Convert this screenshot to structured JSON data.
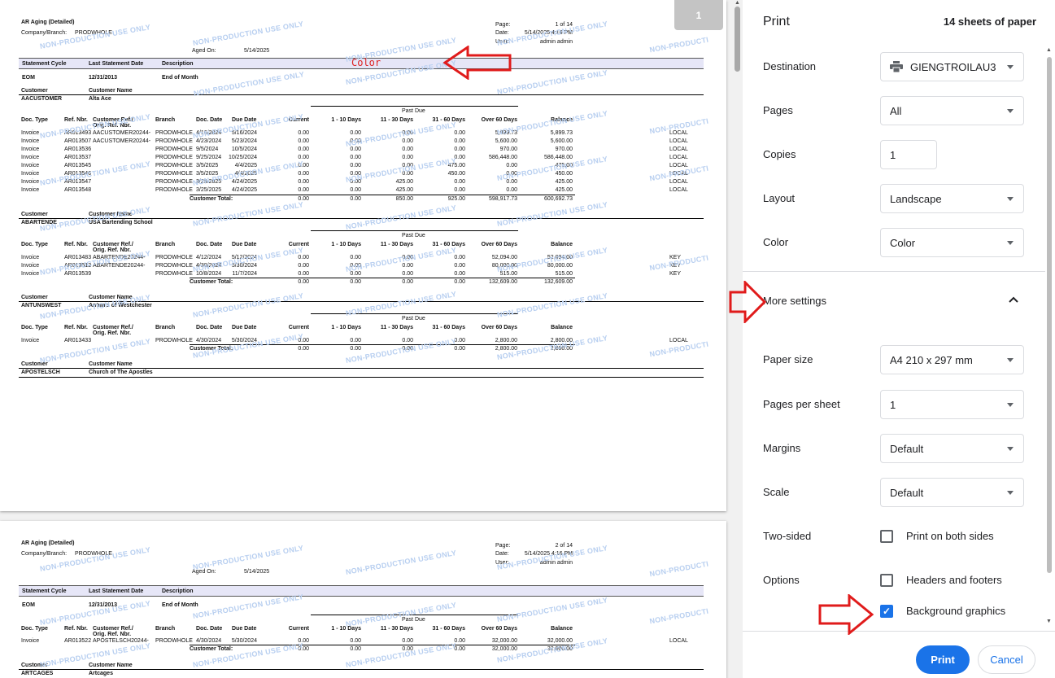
{
  "report": {
    "title": "AR Aging (Detailed)",
    "company_label": "Company/Branch:",
    "company": "PRODWHOLE",
    "aged_on_label": "Aged On:",
    "aged_on": "5/14/2025",
    "page_label": "Page:",
    "page1": "1 of 14",
    "page2": "2 of 14",
    "date_label": "Date:",
    "date": "5/14/2025 4:16 PM",
    "user_label": "User:",
    "user": "admin admin",
    "watermark": "NON-PRODUCTION USE ONLY",
    "watermark_cut": "NON-PRODUCTI",
    "band_cols": [
      "Statement Cycle",
      "Last Statement Date",
      "Description"
    ],
    "cycle": [
      "EOM",
      "12/31/2013",
      "End of Month"
    ],
    "cust_header": [
      "Customer",
      "Customer Name"
    ],
    "past_due": "Past Due",
    "col_heads": [
      "Doc. Type",
      "Ref. Nbr.",
      "Customer Ref./",
      "Orig. Ref. Nbr.",
      "Branch",
      "Doc. Date",
      "Due Date",
      "Current",
      "1 - 10 Days",
      "11 - 30 Days",
      "31 - 60 Days",
      "Over 60 Days",
      "Balance"
    ],
    "customer_total": "Customer Total:",
    "groups": [
      {
        "id": "AACUSTOMER",
        "name": "Alta Ace",
        "rows": [
          [
            "Invoice",
            "AR013493",
            "AACUSTOMER20244-",
            "PRODWHOLE",
            "4/16/2024",
            "5/16/2024",
            "0.00",
            "0.00",
            "0.00",
            "0.00",
            "5,899.73",
            "5,899.73",
            "LOCAL"
          ],
          [
            "Invoice",
            "AR013507",
            "AACUSTOMER20244-",
            "PRODWHOLE",
            "4/23/2024",
            "5/23/2024",
            "0.00",
            "0.00",
            "0.00",
            "0.00",
            "5,600.00",
            "5,600.00",
            "LOCAL"
          ],
          [
            "Invoice",
            "AR013536",
            "",
            "PRODWHOLE",
            "9/5/2024",
            "10/5/2024",
            "0.00",
            "0.00",
            "0.00",
            "0.00",
            "970.00",
            "970.00",
            "LOCAL"
          ],
          [
            "Invoice",
            "AR013537",
            "",
            "PRODWHOLE",
            "9/25/2024",
            "10/25/2024",
            "0.00",
            "0.00",
            "0.00",
            "0.00",
            "586,448.00",
            "586,448.00",
            "LOCAL"
          ],
          [
            "Invoice",
            "AR013545",
            "",
            "PRODWHOLE",
            "3/5/2025",
            "4/4/2025",
            "0.00",
            "0.00",
            "0.00",
            "475.00",
            "0.00",
            "475.00",
            "LOCAL"
          ],
          [
            "Invoice",
            "AR013546",
            "",
            "PRODWHOLE",
            "3/5/2025",
            "4/4/2025",
            "0.00",
            "0.00",
            "0.00",
            "450.00",
            "0.00",
            "450.00",
            "LOCAL"
          ],
          [
            "Invoice",
            "AR013547",
            "",
            "PRODWHOLE",
            "3/25/2025",
            "4/24/2025",
            "0.00",
            "0.00",
            "425.00",
            "0.00",
            "0.00",
            "425.00",
            "LOCAL"
          ],
          [
            "Invoice",
            "AR013548",
            "",
            "PRODWHOLE",
            "3/25/2025",
            "4/24/2025",
            "0.00",
            "0.00",
            "425.00",
            "0.00",
            "0.00",
            "425.00",
            "LOCAL"
          ]
        ],
        "total": [
          "0.00",
          "0.00",
          "850.00",
          "925.00",
          "598,917.73",
          "600,692.73"
        ]
      },
      {
        "id": "ABARTENDE",
        "name": "USA Bartending School",
        "rows": [
          [
            "Invoice",
            "AR013483",
            "ABARTENDE20244-",
            "PRODWHOLE",
            "4/12/2024",
            "5/12/2024",
            "0.00",
            "0.00",
            "0.00",
            "0.00",
            "52,094.00",
            "52,094.00",
            "KEY"
          ],
          [
            "Invoice",
            "AR013512",
            "ABARTENDE20244-",
            "PRODWHOLE",
            "4/30/2024",
            "5/30/2024",
            "0.00",
            "0.00",
            "0.00",
            "0.00",
            "80,000.00",
            "80,000.00",
            "KEY"
          ],
          [
            "Invoice",
            "AR013539",
            "",
            "PRODWHOLE",
            "10/8/2024",
            "11/7/2024",
            "0.00",
            "0.00",
            "0.00",
            "0.00",
            "515.00",
            "515.00",
            "KEY"
          ]
        ],
        "total": [
          "0.00",
          "0.00",
          "0.00",
          "0.00",
          "132,609.00",
          "132,609.00"
        ]
      },
      {
        "id": "ANTUNSWEST",
        "name": "Antun's of Westchester",
        "rows": [
          [
            "Invoice",
            "AR013433",
            "",
            "PRODWHOLE",
            "4/30/2024",
            "5/30/2024",
            "0.00",
            "0.00",
            "0.00",
            "0.00",
            "2,800.00",
            "2,800.00",
            "LOCAL"
          ]
        ],
        "total": [
          "0.00",
          "0.00",
          "0.00",
          "0.00",
          "2,800.00",
          "2,800.00"
        ]
      },
      {
        "id": "APOSTELSCH",
        "name": "Church of The Apostles",
        "rows": [],
        "total": []
      }
    ],
    "page2_group": {
      "id": "APOSTELSCH",
      "row": [
        "Invoice",
        "AR013522",
        "APOSTELSCH20244-",
        "PRODWHOLE",
        "4/30/2024",
        "5/30/2024",
        "0.00",
        "0.00",
        "0.00",
        "0.00",
        "32,000.00",
        "32,000.00",
        "LOCAL"
      ],
      "total": [
        "0.00",
        "0.00",
        "0.00",
        "0.00",
        "32,000.00",
        "32,000.00"
      ]
    },
    "next_customer": {
      "id": "ARTCAGES",
      "name": "Artcages"
    }
  },
  "annotation": "Color",
  "page_badge": "1",
  "print": {
    "title": "Print",
    "sheets": "14 sheets of paper",
    "destination_label": "Destination",
    "destination": "GIENGTROILAU3",
    "pages_label": "Pages",
    "pages": "All",
    "copies_label": "Copies",
    "copies": "1",
    "layout_label": "Layout",
    "layout": "Landscape",
    "color_label": "Color",
    "color": "Color",
    "more_settings": "More settings",
    "paper_size_label": "Paper size",
    "paper_size": "A4 210 x 297 mm",
    "pps_label": "Pages per sheet",
    "pps": "1",
    "margins_label": "Margins",
    "margins": "Default",
    "scale_label": "Scale",
    "scale": "Default",
    "two_sided_label": "Two-sided",
    "two_sided": "Print on both sides",
    "options_label": "Options",
    "headers_footers": "Headers and footers",
    "background_graphics": "Background graphics",
    "print_btn": "Print",
    "cancel_btn": "Cancel",
    "accent": "#1a73e8"
  }
}
